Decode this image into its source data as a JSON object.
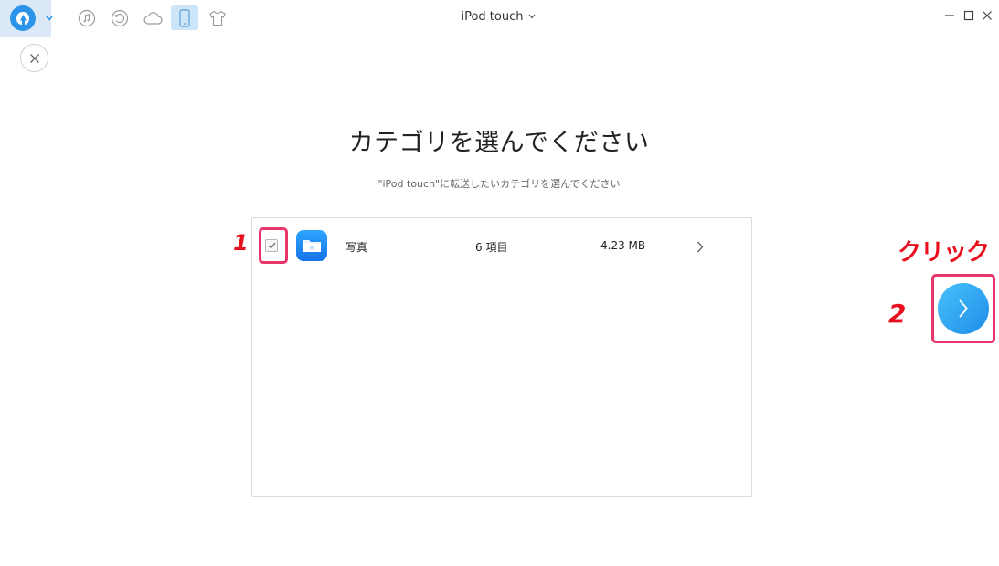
{
  "titlebar": {
    "device_name": "iPod touch",
    "nav_icons": [
      "music-icon",
      "history-icon",
      "cloud-icon",
      "device-icon",
      "shirt-icon"
    ],
    "active_nav": "device-icon",
    "window_controls": [
      "minimize",
      "maximize",
      "close"
    ]
  },
  "main": {
    "heading": "カテゴリを選んでください",
    "subheading": "\"iPod touch\"に転送したいカテゴリを選んでください"
  },
  "categories": [
    {
      "name": "写真",
      "count": "6 項目",
      "size": "4.23 MB",
      "checked": true,
      "icon": "photos-folder-icon"
    }
  ],
  "annotations": {
    "step1": "1",
    "step2": "2",
    "click_label": "クリック"
  },
  "colors": {
    "accent": "#2b93e8",
    "next_button": "#2f9ff0",
    "annotation_red": "#e8101e",
    "highlight_pink": "#e8366a"
  }
}
